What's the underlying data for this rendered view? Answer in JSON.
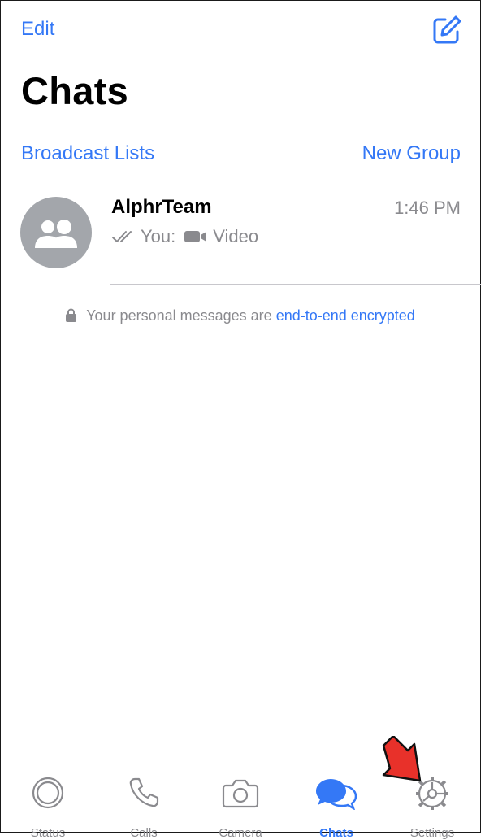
{
  "header": {
    "edit_label": "Edit",
    "compose_icon": "compose-icon",
    "title": "Chats"
  },
  "links": {
    "broadcast_label": "Broadcast Lists",
    "new_group_label": "New Group"
  },
  "chats": [
    {
      "name": "AlphrTeam",
      "time": "1:46 PM",
      "sender": "You:",
      "media_label": "Video",
      "status_icon": "double-check-icon",
      "media_icon": "video-camera-icon",
      "avatar_icon": "group-avatar-icon"
    }
  ],
  "encryption": {
    "text": "Your personal messages are",
    "link": "end-to-end encrypted"
  },
  "tabs": [
    {
      "label": "Status",
      "icon": "status-icon",
      "active": false
    },
    {
      "label": "Calls",
      "icon": "phone-icon",
      "active": false
    },
    {
      "label": "Camera",
      "icon": "camera-icon",
      "active": false
    },
    {
      "label": "Chats",
      "icon": "chat-bubbles-icon",
      "active": true
    },
    {
      "label": "Settings",
      "icon": "gear-icon",
      "active": false
    }
  ],
  "colors": {
    "accent": "#3478f6",
    "secondary_text": "#8a8a8e",
    "annotation_arrow": "#e8312a"
  }
}
